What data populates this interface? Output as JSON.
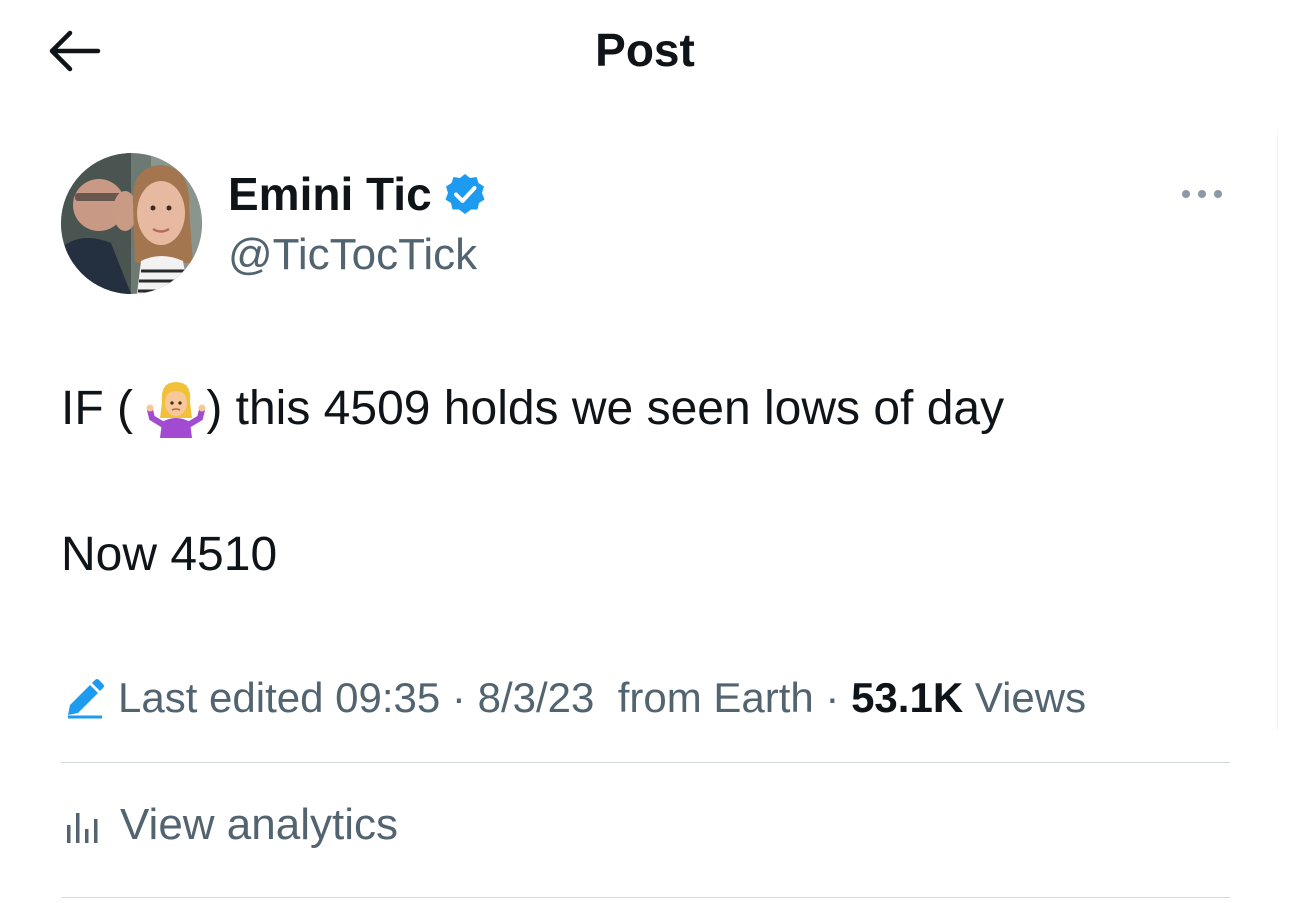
{
  "header": {
    "title": "Post"
  },
  "author": {
    "display_name": "Emini Tic",
    "handle": "@TicTocTick",
    "verified": true
  },
  "tweet": {
    "line1_prefix": "IF (",
    "line1_emoji": "person-shrugging-emoji",
    "line1_suffix": ") this 4509 holds we seen lows of day",
    "line2": "Now 4510"
  },
  "meta": {
    "edited": "Last edited 09:35 · 8/3/23  from Earth · ",
    "views_count": "53.1K",
    "views_label": "Views"
  },
  "analytics": {
    "label": "View analytics"
  },
  "colors": {
    "text": "#0f1419",
    "secondary": "#536471",
    "accent": "#1d9bf0",
    "divider": "#cfd9de"
  }
}
